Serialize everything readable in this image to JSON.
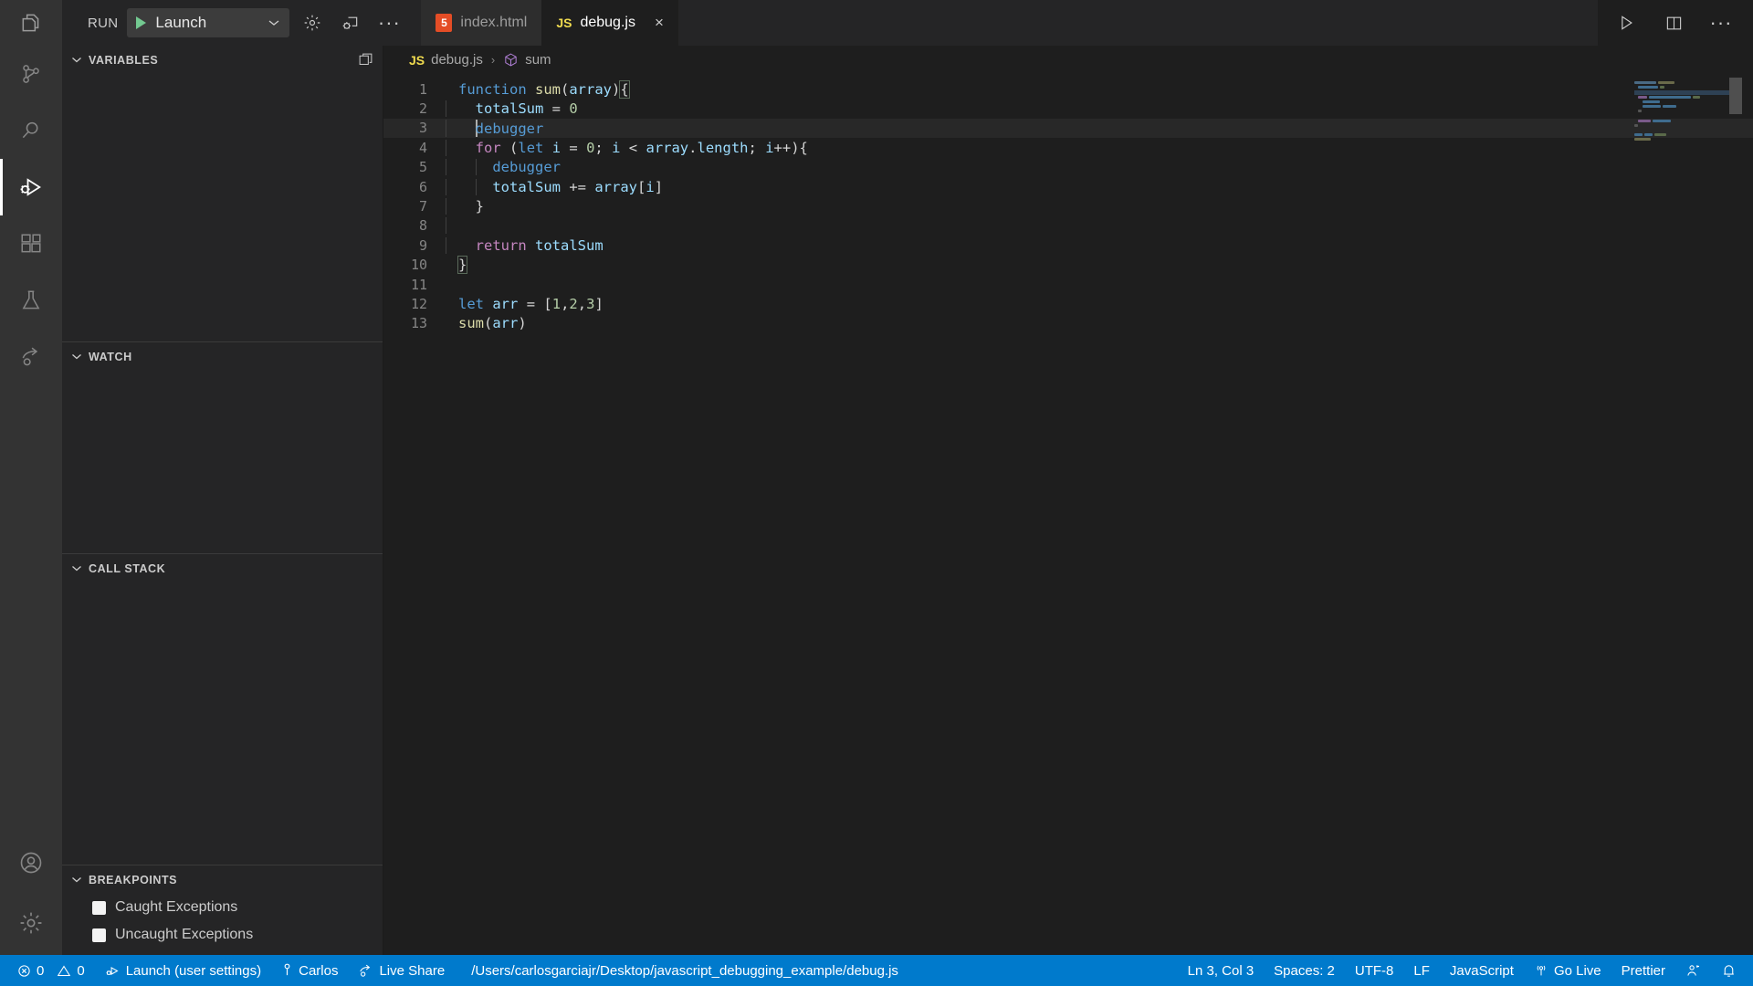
{
  "window": {
    "theme_bg": "#1e1e1e",
    "accent": "#007acc"
  },
  "run_toolbar": {
    "run_label": "RUN",
    "configuration": "Launch",
    "dropdown_chevron": "chevron-down-icon",
    "settings_icon": "gear-icon",
    "debug_console_icon": "debug-console-icon",
    "more_label": "···"
  },
  "tabs": [
    {
      "label": "index.html",
      "icon": "html5-icon",
      "icon_text": "5",
      "active": false
    },
    {
      "label": "debug.js",
      "icon": "js-icon",
      "icon_text": "JS",
      "active": true,
      "close": "×"
    }
  ],
  "editor_actions": {
    "run_icon": "run-play-icon",
    "split_icon": "split-editor-icon",
    "more_icon": "ellipsis-icon"
  },
  "breadcrumb": {
    "file_icon": "js-icon",
    "file_icon_text": "JS",
    "file": "debug.js",
    "separator": "›",
    "symbol_icon": "symbol-method-icon",
    "symbol": "sum"
  },
  "activity_bar": {
    "items": [
      {
        "name": "explorer",
        "icon": "files-icon",
        "active": false
      },
      {
        "name": "source-control",
        "icon": "source-control-icon",
        "active": false
      },
      {
        "name": "search",
        "icon": "search-icon",
        "active": false
      },
      {
        "name": "run-and-debug",
        "icon": "debug-alt-icon",
        "active": true
      },
      {
        "name": "extensions",
        "icon": "extensions-icon",
        "active": false
      },
      {
        "name": "testing",
        "icon": "beaker-icon",
        "active": false
      },
      {
        "name": "live-share",
        "icon": "live-share-icon",
        "active": false
      }
    ],
    "bottom_items": [
      {
        "name": "accounts",
        "icon": "account-icon"
      },
      {
        "name": "manage",
        "icon": "gear-icon"
      }
    ]
  },
  "sidebar": {
    "panels": [
      {
        "title": "VARIABLES",
        "chevron": "chevron-down-icon",
        "action_icon": "open-panel-icon",
        "items": []
      },
      {
        "title": "WATCH",
        "chevron": "chevron-down-icon",
        "items": []
      },
      {
        "title": "CALL STACK",
        "chevron": "chevron-down-icon",
        "items": []
      },
      {
        "title": "BREAKPOINTS",
        "chevron": "chevron-down-icon",
        "items": [
          {
            "label": "Caught Exceptions",
            "checked": false
          },
          {
            "label": "Uncaught Exceptions",
            "checked": false
          }
        ]
      }
    ]
  },
  "code": {
    "language": "javascript",
    "highlighted_line": 3,
    "lines": [
      {
        "n": "1",
        "text": "function sum(array){"
      },
      {
        "n": "2",
        "text": "  totalSum = 0"
      },
      {
        "n": "3",
        "text": "  debugger"
      },
      {
        "n": "4",
        "text": "  for (let i = 0; i < array.length; i++){"
      },
      {
        "n": "5",
        "text": "    debugger"
      },
      {
        "n": "6",
        "text": "    totalSum += array[i]"
      },
      {
        "n": "7",
        "text": "  }"
      },
      {
        "n": "8",
        "text": ""
      },
      {
        "n": "9",
        "text": "  return totalSum"
      },
      {
        "n": "10",
        "text": "}"
      },
      {
        "n": "11",
        "text": ""
      },
      {
        "n": "12",
        "text": "let arr = [1,2,3]"
      },
      {
        "n": "13",
        "text": "sum(arr)"
      }
    ]
  },
  "status_bar": {
    "errors_icon": "error-icon",
    "errors": "0",
    "warnings_icon": "warning-icon",
    "warnings": "0",
    "debug_icon": "debug-icon",
    "debug_config": "Launch (user settings)",
    "account_icon": "person-icon",
    "account": "Carlos",
    "live_share_icon": "live-share-icon",
    "live_share": "Live Share",
    "file_path": "/Users/carlosgarciajr/Desktop/javascript_debugging_example/debug.js",
    "cursor_position": "Ln 3, Col 3",
    "indentation": "Spaces: 2",
    "encoding": "UTF-8",
    "eol": "LF",
    "language_mode": "JavaScript",
    "go_live_icon": "broadcast-icon",
    "go_live": "Go Live",
    "formatter": "Prettier",
    "feedback_icon": "feedback-icon",
    "bell_icon": "bell-icon"
  }
}
